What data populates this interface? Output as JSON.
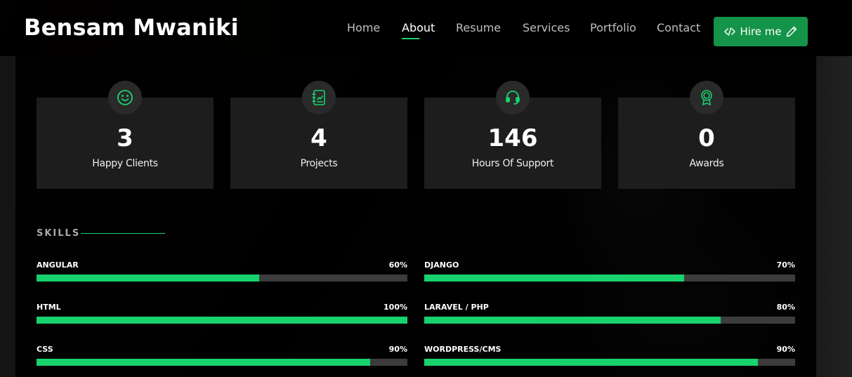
{
  "header": {
    "logo": "Bensam Mwaniki",
    "nav": [
      {
        "label": "Home",
        "active": false
      },
      {
        "label": "About",
        "active": true
      },
      {
        "label": "Resume",
        "active": false
      },
      {
        "label": "Services",
        "active": false
      },
      {
        "label": "Portfolio",
        "active": false
      },
      {
        "label": "Contact",
        "active": false
      }
    ],
    "hire_label": "Hire me",
    "accent": "#18d26e",
    "button_color": "#149448"
  },
  "counts": [
    {
      "number": "3",
      "label": "Happy Clients",
      "icon": "smiley-icon"
    },
    {
      "number": "4",
      "label": "Projects",
      "icon": "journal-icon"
    },
    {
      "number": "146",
      "label": "Hours Of Support",
      "icon": "headset-icon"
    },
    {
      "number": "0",
      "label": "Awards",
      "icon": "award-icon"
    }
  ],
  "skills": {
    "title": "SKILLS",
    "items": [
      {
        "name": "ANGULAR",
        "value": "60%",
        "percent": 60
      },
      {
        "name": "DJANGO",
        "value": "70%",
        "percent": 70
      },
      {
        "name": "HTML",
        "value": "100%",
        "percent": 100
      },
      {
        "name": "LARAVEL / PHP",
        "value": "80%",
        "percent": 80
      },
      {
        "name": "CSS",
        "value": "90%",
        "percent": 90
      },
      {
        "name": "WORDPRESS/CMS",
        "value": "90%",
        "percent": 90
      }
    ]
  }
}
